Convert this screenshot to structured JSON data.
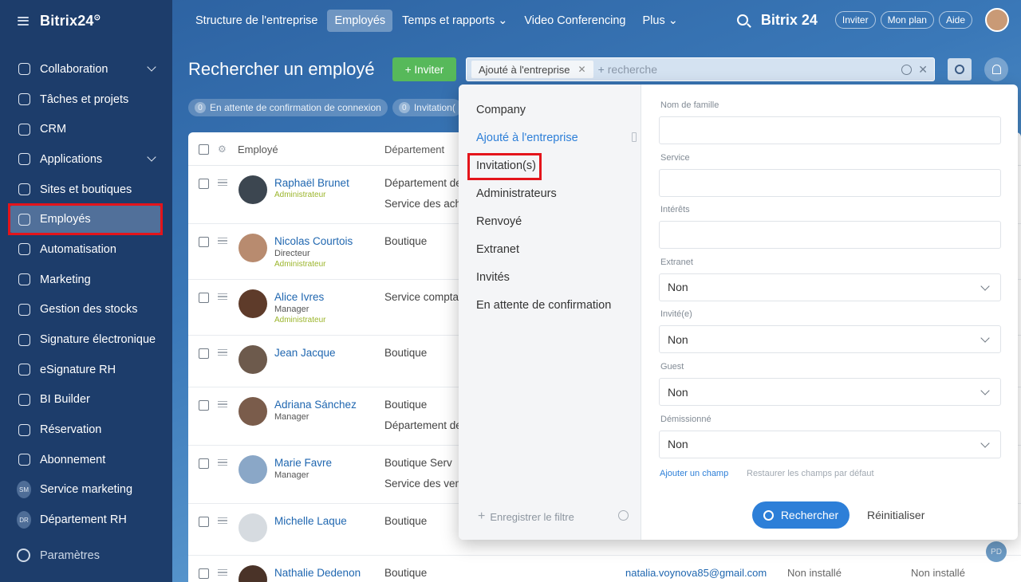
{
  "app": {
    "brand": "Bitrix24",
    "brand_mark": "⊙"
  },
  "sidebar": {
    "items": [
      {
        "label": "Collaboration",
        "icon": "chat-bubbles-icon",
        "chevron": true
      },
      {
        "label": "Tâches et projets",
        "icon": "checkbox-icon",
        "chevron": false
      },
      {
        "label": "CRM",
        "icon": "crm-filter-icon",
        "chevron": false
      },
      {
        "label": "Applications",
        "icon": "cube-icon",
        "chevron": true
      },
      {
        "label": "Sites et boutiques",
        "icon": "cart-icon",
        "chevron": false
      },
      {
        "label": "Employés",
        "icon": "id-card-icon",
        "chevron": false,
        "active": true
      },
      {
        "label": "Automatisation",
        "icon": "robot-icon",
        "chevron": false
      },
      {
        "label": "Marketing",
        "icon": "target-icon",
        "chevron": false
      },
      {
        "label": "Gestion des stocks",
        "icon": "box-icon",
        "chevron": false
      },
      {
        "label": "Signature électronique",
        "icon": "pen-icon",
        "chevron": false
      },
      {
        "label": "eSignature RH",
        "icon": "doc-sign-icon",
        "chevron": false
      },
      {
        "label": "BI Builder",
        "icon": "bar-chart-icon",
        "chevron": false
      },
      {
        "label": "Réservation",
        "icon": "calendar-icon",
        "chevron": false
      },
      {
        "label": "Abonnement",
        "icon": "subscription-icon",
        "chevron": false
      },
      {
        "label": "Service marketing",
        "avatar": "SM"
      },
      {
        "label": "Département RH",
        "avatar": "DR"
      }
    ],
    "settings": "Paramètres"
  },
  "topnav": {
    "items": [
      "Structure de l'entreprise",
      "Employés",
      "Temps et rapports ⌄",
      "Video Conferencing",
      "Plus ⌄"
    ],
    "selected_index": 1,
    "right_brand": "Bitrix 24",
    "pills": [
      "Inviter",
      "Mon plan",
      "Aide"
    ]
  },
  "page": {
    "title": "Rechercher un employé",
    "invite_button": "+  Inviter",
    "search": {
      "chip": "Ajouté à l'entreprise",
      "placeholder": "recherche"
    },
    "counters": [
      {
        "n": "0",
        "label": "En attente de confirmation de connexion"
      },
      {
        "n": "0",
        "label": "Invitation("
      }
    ]
  },
  "table": {
    "headers": {
      "employee": "Employé",
      "department": "Département"
    },
    "rows": [
      {
        "name": "Raphaël Brunet",
        "position": "",
        "role": "Administrateur",
        "dept": "Département de",
        "dept2": "Service des acha",
        "avatar_color": "#3c4650"
      },
      {
        "name": "Nicolas Courtois",
        "position": "Directeur",
        "role": "Administrateur",
        "dept": "Boutique",
        "dept2": "",
        "avatar_color": "#b88b6f"
      },
      {
        "name": "Alice Ivres",
        "position": "Manager",
        "role": "Administrateur",
        "dept": "Service comptab",
        "dept2": "",
        "avatar_color": "#5e3b2a"
      },
      {
        "name": "Jean Jacque",
        "position": "",
        "role": "",
        "dept": "Boutique",
        "dept2": "",
        "avatar_color": "#6d5a4c"
      },
      {
        "name": "Adriana Sánchez",
        "position": "Manager",
        "role": "",
        "dept": "Boutique",
        "dept2": "Département de",
        "avatar_color": "#7a5c4b"
      },
      {
        "name": "Marie Favre",
        "position": "Manager",
        "role": "",
        "dept": "Boutique     Serv",
        "dept2": "Service des vent",
        "avatar_color": "#8aa7c7"
      },
      {
        "name": "Michelle Laque",
        "position": "",
        "role": "",
        "dept": "Boutique",
        "dept2": "",
        "avatar_color": "#d6dbe0"
      },
      {
        "name": "Nathalie Dedenon",
        "position": "",
        "role": "",
        "dept": "Boutique",
        "dept2": "",
        "email": "natalia.voynova85@gmail.com",
        "st1": "Non installé",
        "st2": "Non installé",
        "avatar_color": "#4a3328"
      }
    ]
  },
  "floating_avatar": "PD",
  "filter_panel": {
    "presets": [
      "Company",
      "Ajouté à l'entreprise",
      "Invitation(s)",
      "Administrateurs",
      "Renvoyé",
      "Extranet",
      "Invités",
      "En attente de confirmation"
    ],
    "active_preset_index": 1,
    "highlighted_preset_index": 2,
    "save_filter": "Enregistrer le filtre",
    "fields": [
      {
        "label": "Nom de famille",
        "type": "text",
        "value": ""
      },
      {
        "label": "Service",
        "type": "text",
        "value": ""
      },
      {
        "label": "Intérêts",
        "type": "text",
        "value": ""
      },
      {
        "label": "Extranet",
        "type": "select",
        "value": "Non"
      },
      {
        "label": "Invité(e)",
        "type": "select",
        "value": "Non"
      },
      {
        "label": "Guest",
        "type": "select",
        "value": "Non"
      },
      {
        "label": "Démissionné",
        "type": "select",
        "value": "Non"
      }
    ],
    "add_field": "Ajouter un champ",
    "restore_fields": "Restaurer les champs par défaut",
    "search_button": "Rechercher",
    "reset_button": "Réinitialiser"
  },
  "colors": {
    "accent_blue": "#2d7fd8",
    "invite_green": "#57b95a",
    "highlight_red": "#e4141b",
    "sidebar_bg": "#1d3d6b"
  }
}
